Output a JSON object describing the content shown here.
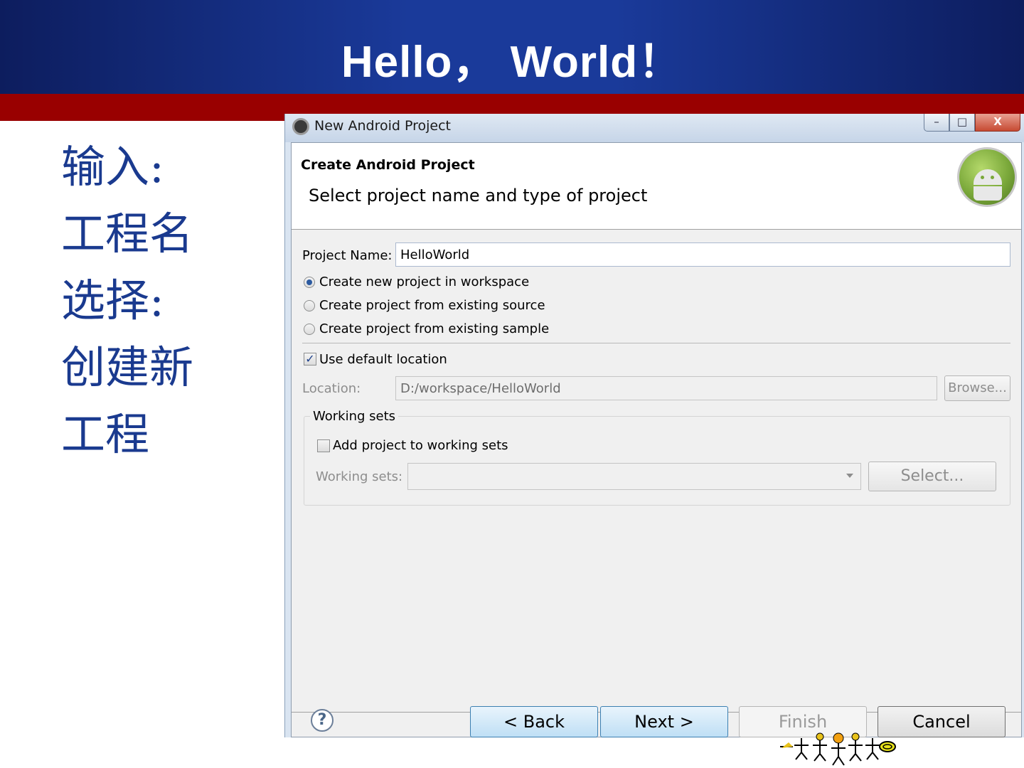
{
  "slide": {
    "title": "Hello， World！",
    "left_lines": [
      "输入:",
      "工程名",
      "选择:",
      "创建新",
      "工程"
    ]
  },
  "window": {
    "title": "New Android Project",
    "controls": {
      "minimize": "–",
      "maximize": "□",
      "close": "X"
    }
  },
  "banner": {
    "title": "Create Android Project",
    "subtitle": "Select project name and type of project",
    "logo_icon": "android-logo-icon"
  },
  "form": {
    "project_name_label": "Project Name:",
    "project_name_value": "HelloWorld",
    "radios": [
      {
        "label": "Create new project in workspace",
        "selected": true
      },
      {
        "label": "Create project from existing source",
        "selected": false
      },
      {
        "label": "Create project from existing sample",
        "selected": false
      }
    ],
    "use_default_location_label": "Use default location",
    "use_default_location_checked": true,
    "location_label": "Location:",
    "location_value": "D:/workspace/HelloWorld",
    "browse_label": "Browse...",
    "working_sets_group": "Working sets",
    "add_to_working_sets_label": "Add project to working sets",
    "add_to_working_sets_checked": false,
    "working_sets_label": "Working sets:",
    "working_sets_value": "",
    "select_label": "Select..."
  },
  "footer": {
    "help_icon": "?",
    "back": "< Back",
    "next": "Next >",
    "finish": "Finish",
    "cancel": "Cancel"
  },
  "colors": {
    "header_blue": "#1a3a9a",
    "band_red": "#990000",
    "left_text": "#1a3a8f"
  }
}
